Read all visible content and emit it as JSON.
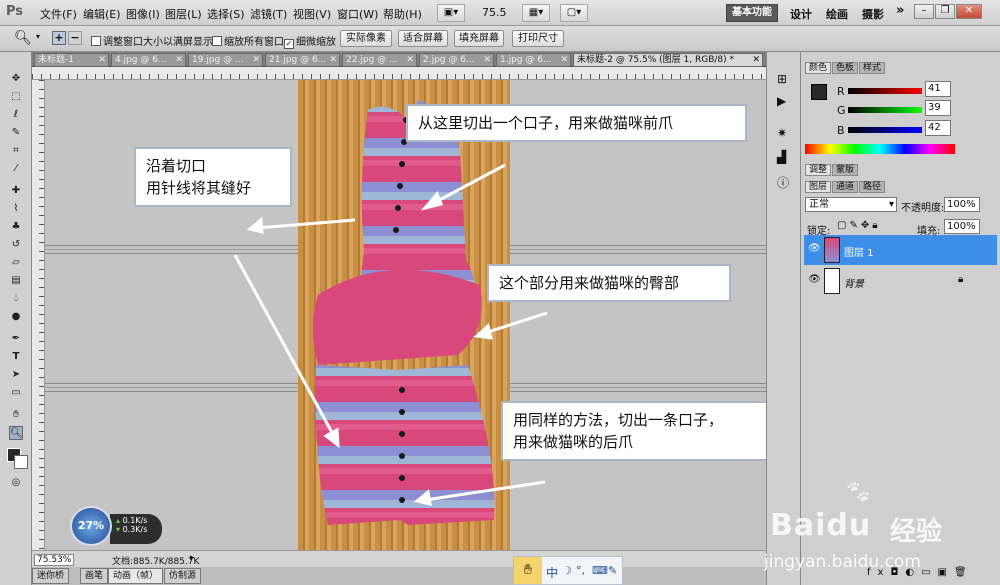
{
  "menubar": {
    "logo": "Ps",
    "items": [
      "文件(F)",
      "编辑(E)",
      "图像(I)",
      "图层(L)",
      "选择(S)",
      "滤镜(T)",
      "视图(V)",
      "窗口(W)",
      "帮助(H)"
    ],
    "zoom": "75.5",
    "workspace_active": "基本功能",
    "workspaces": [
      "设计",
      "绘画",
      "摄影"
    ],
    "more": "»"
  },
  "options": {
    "checks": [
      {
        "label": "调整窗口大小以满屏显示",
        "checked": false
      },
      {
        "label": "缩放所有窗口",
        "checked": false
      },
      {
        "label": "细微缩放",
        "checked": true
      }
    ],
    "buttons": [
      "实际像素",
      "适合屏幕",
      "填充屏幕",
      "打印尺寸"
    ]
  },
  "tabs": [
    {
      "label": "未标题-1"
    },
    {
      "label": "4.jpg @ 6..."
    },
    {
      "label": "19.jpg @ ..."
    },
    {
      "label": "21.jpg @ 6..."
    },
    {
      "label": "22.jpg @ ..."
    },
    {
      "label": "2.jpg @ 6..."
    },
    {
      "label": "1.jpg @ 6..."
    },
    {
      "label": "未标题-2 @ 75.5% (图层 1, RGB/8) *"
    }
  ],
  "notes": {
    "cut_front": "从这里切出一个口子，用来做猫咪前爪",
    "sew_line1": "沿着切口",
    "sew_line2": "用针线将其缝好",
    "hip": "这个部分用来做猫咪的臀部",
    "back_line1": "用同样的方法，切出一条口子，",
    "back_line2": "用来做猫咪的后爪"
  },
  "status": {
    "zoom": "75.53%",
    "doc": "文档:885.7K/885.7K"
  },
  "bottom_tabs": [
    "迷你桥",
    "画笔",
    "动画（帧）",
    "仿制源"
  ],
  "color_panel": {
    "tabs": [
      "颜色",
      "色板",
      "样式"
    ],
    "r_label": "R",
    "g_label": "G",
    "b_label": "B",
    "r": "41",
    "g": "39",
    "b": "42"
  },
  "adjust_tabs": [
    "调整",
    "蒙版"
  ],
  "layers_panel": {
    "tabs": [
      "图层",
      "通道",
      "路径"
    ],
    "blend": "正常",
    "opacity_label": "不透明度:",
    "opacity": "100%",
    "lock_label": "锁定:",
    "fill_label": "填充:",
    "fill": "100%",
    "layers": [
      {
        "name": "图层 1",
        "selected": true
      },
      {
        "name": "背景",
        "selected": false
      }
    ]
  },
  "netmon": {
    "percent": "27%",
    "up": "0.1K/s",
    "down": "0.3K/s"
  },
  "ime": {
    "label": "中"
  },
  "watermark": {
    "brand": "Baidu",
    "brand_cn": "经验",
    "url": "jingyan.baidu.com"
  }
}
